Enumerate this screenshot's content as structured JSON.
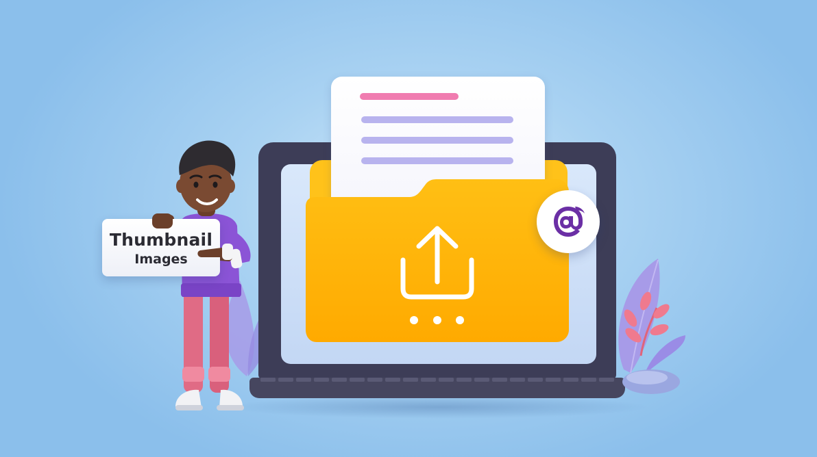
{
  "sign": {
    "title": "Thumbnail",
    "subtitle": "Images"
  },
  "icons": {
    "upload": "upload-arrow-icon",
    "more": "three-dots-icon",
    "blazor": "blazor-at-icon"
  },
  "colors": {
    "background": "#a9d2f2",
    "folder": "#ffb800",
    "laptop": "#3d3d57",
    "badge_icon": "#6b2fa5",
    "accent_line": "#f07cb0",
    "paper_line": "#b8b3ee",
    "shirt": "#8b54d6",
    "pants": "#e06b85"
  }
}
